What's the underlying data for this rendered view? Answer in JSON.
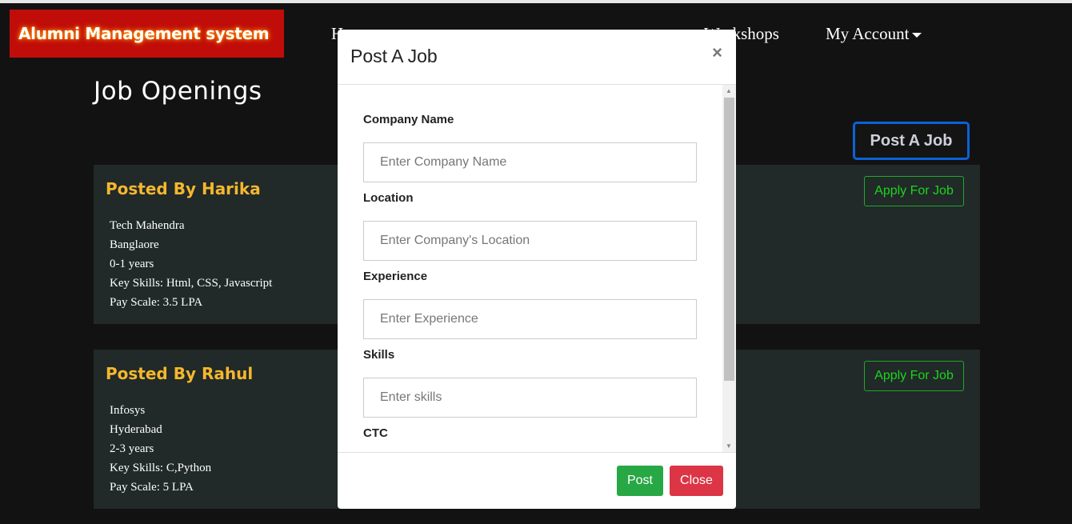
{
  "brand": "Alumni Management system",
  "nav": {
    "home": "H",
    "workshops": "Workshops",
    "account": "My Account"
  },
  "title": "Job Openings",
  "post_job": "Post A Job",
  "jobs": [
    {
      "posted_by": "Posted By Harika",
      "company": "Tech Mahendra",
      "location": "Banglaore",
      "experience": "0-1 years",
      "skills": "Key Skills: Html, CSS, Javascript",
      "pay": "Pay Scale: 3.5 LPA",
      "apply": "Apply For Job"
    },
    {
      "posted_by": "Posted By Rahul",
      "company": "Infosys",
      "location": "Hyderabad",
      "experience": "2-3 years",
      "skills": "Key Skills: C,Python",
      "pay": "Pay Scale: 5 LPA",
      "apply": "Apply For Job"
    }
  ],
  "modal": {
    "title": "Post A Job",
    "close_x": "×",
    "fields": [
      {
        "label": "Company Name",
        "placeholder": "Enter Company Name"
      },
      {
        "label": "Location",
        "placeholder": "Enter Company's Location"
      },
      {
        "label": "Experience",
        "placeholder": "Enter Experience"
      },
      {
        "label": "Skills",
        "placeholder": "Enter skills"
      },
      {
        "label": "CTC"
      }
    ],
    "post": "Post",
    "close": "Close"
  }
}
